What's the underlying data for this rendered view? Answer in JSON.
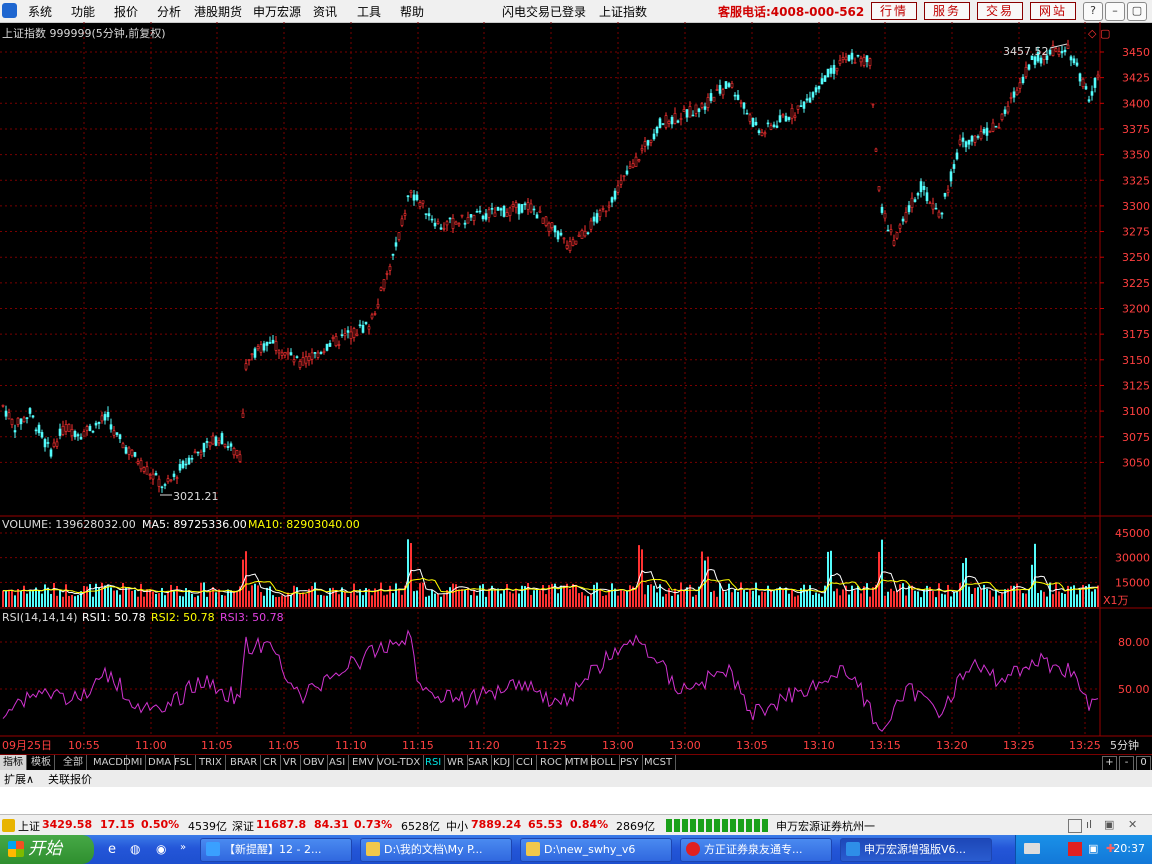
{
  "menu": {
    "left": [
      "系统",
      "功能",
      "报价",
      "分析",
      "港股期货",
      "申万宏源",
      "资讯",
      "工具",
      "帮助"
    ],
    "status": "闪电交易已登录",
    "index_name": "上证指数",
    "hotline": "客服电话:4008-000-562",
    "buttons": [
      "行情",
      "服务",
      "交易",
      "网站"
    ],
    "window_controls": [
      "?",
      "–",
      "▢",
      "✕"
    ]
  },
  "chart": {
    "title": "上证指数 999999(5分钟,前复权)",
    "high_label": "3457.52",
    "low_label": "3021.21",
    "price_ticks": [
      "3450",
      "3425",
      "3400",
      "3375",
      "3350",
      "3325",
      "3300",
      "3275",
      "3250",
      "3225",
      "3200",
      "3175",
      "3150",
      "3125",
      "3100",
      "3075",
      "3050"
    ],
    "volume_title": "VOLUME: 139628032.00",
    "volume_ma5": "MA5: 89725336.00",
    "volume_ma10": "MA10: 82903040.00",
    "volume_ticks": [
      "45000",
      "30000",
      "15000"
    ],
    "volume_unit": "X1万",
    "rsi_label": "RSI(14,14,14)",
    "rsi1": "RSI1: 50.78",
    "rsi2": "RSI2: 50.78",
    "rsi3": "RSI3: 50.78",
    "rsi_ticks": [
      "80.00",
      "50.00"
    ],
    "time_ticks": [
      "09月25日",
      "10:55",
      "11:00",
      "11:05",
      "11:05",
      "11:10",
      "11:15",
      "11:20",
      "11:25",
      "13:00",
      "13:00",
      "13:05",
      "13:10",
      "13:15",
      "13:20",
      "13:25",
      "13:25"
    ],
    "period": "5分钟"
  },
  "tabs": [
    "指标",
    "模板",
    "全部",
    "MACD",
    "DMI",
    "DMA",
    "FSL",
    "TRIX",
    "BRAR",
    "CR",
    "VR",
    "OBV",
    "ASI",
    "EMV",
    "VOL-TDX",
    "RSI",
    "WR",
    "SAR",
    "KDJ",
    "CCI",
    "ROC",
    "MTM",
    "BOLL",
    "PSY",
    "MCST"
  ],
  "tab_controls": [
    "+",
    "-",
    "0"
  ],
  "ext": [
    "扩展∧",
    "关联报价"
  ],
  "quote": {
    "sh_label": "上证",
    "sh_price": "3429.58",
    "sh_change": "17.15",
    "sh_pct": "0.50%",
    "sh_amount": "4539亿",
    "sz_label": "深证",
    "sz_price": "11687.8",
    "sz_change": "84.31",
    "sz_pct": "0.73%",
    "sz_amount": "6528亿",
    "zx_label": "中小",
    "zx_price": "7889.24",
    "zx_change": "65.53",
    "zx_pct": "0.84%",
    "zx_amount": "2869亿",
    "broker": "申万宏源证券杭州一"
  },
  "taskbar": {
    "start": "开始",
    "tasks": [
      "【新提醒】12 - 2...",
      "D:\\我的文档\\My P...",
      "D:\\new_swhy_v6",
      "方正证券泉友通专...",
      "申万宏源增强版V6..."
    ],
    "clock": "20:37"
  },
  "colors": {
    "up": "#ff3232",
    "down": "#54fcfc",
    "grid": "#7a0000",
    "rsi": "#d033d0",
    "ma5": "#ffffff",
    "ma10": "#ffff00"
  }
}
